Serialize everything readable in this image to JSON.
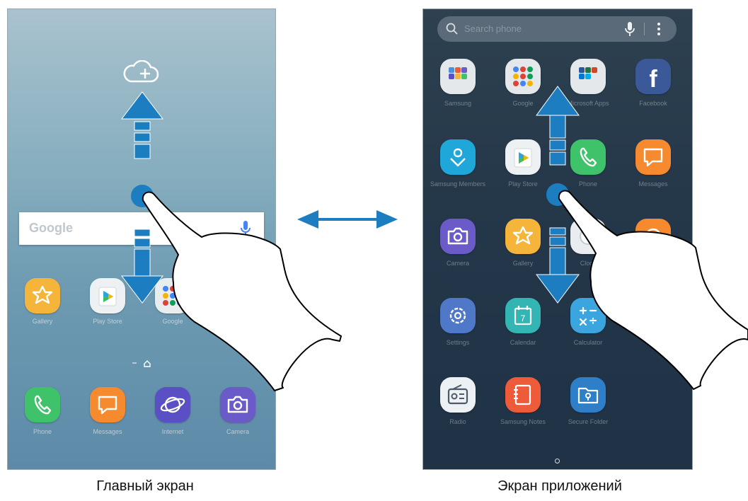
{
  "home_screen": {
    "caption": "Главный экран",
    "google_bar": {
      "logo": "Google"
    },
    "apps": [
      {
        "label": "Gallery",
        "icon": "gallery-icon",
        "color": "#f4b53a"
      },
      {
        "label": "Play Store",
        "icon": "play-store-icon",
        "color": "#eef1f3"
      },
      {
        "label": "Google",
        "icon": "google-folder-icon",
        "color": "#e9edf0"
      }
    ],
    "dock": [
      {
        "label": "Phone",
        "icon": "phone-icon",
        "color": "#3ec26a"
      },
      {
        "label": "Messages",
        "icon": "messages-icon",
        "color": "#f58a2e"
      },
      {
        "label": "Internet",
        "icon": "internet-icon",
        "color": "#5a4fc4"
      },
      {
        "label": "Camera",
        "icon": "camera-icon",
        "color": "#6b5bc9"
      }
    ]
  },
  "apps_screen": {
    "caption": "Экран приложений",
    "search_placeholder": "Search phone",
    "apps": [
      {
        "label": "Samsung",
        "icon": "samsung-folder-icon",
        "color": "#e4e8eb"
      },
      {
        "label": "Google",
        "icon": "google-folder-icon",
        "color": "#e4e8eb"
      },
      {
        "label": "Microsoft Apps",
        "icon": "microsoft-folder-icon",
        "color": "#e4e8eb"
      },
      {
        "label": "Facebook",
        "icon": "facebook-icon",
        "color": "#3b5998"
      },
      {
        "label": "Samsung Members",
        "icon": "samsung-members-icon",
        "color": "#1ea7d8"
      },
      {
        "label": "Play Store",
        "icon": "play-store-icon",
        "color": "#eef1f3"
      },
      {
        "label": "Phone",
        "icon": "phone-icon",
        "color": "#3ec26a"
      },
      {
        "label": "Messages",
        "icon": "messages-icon",
        "color": "#f58a2e"
      },
      {
        "label": "Camera",
        "icon": "camera-icon",
        "color": "#6b5bc9"
      },
      {
        "label": "Gallery",
        "icon": "gallery-icon",
        "color": "#f4b53a"
      },
      {
        "label": "Clock",
        "icon": "clock-icon",
        "color": "#e9edf0"
      },
      {
        "label": "",
        "icon": "orange-app-icon",
        "color": "#f58a2e"
      },
      {
        "label": "Settings",
        "icon": "settings-icon",
        "color": "#4f78c9"
      },
      {
        "label": "Calendar",
        "icon": "calendar-icon",
        "color": "#33b6b3"
      },
      {
        "label": "Calculator",
        "icon": "calculator-icon",
        "color": "#3aa5de"
      },
      {
        "label": "",
        "icon": "partial-app-icon",
        "color": "#25384a"
      },
      {
        "label": "Radio",
        "icon": "radio-icon",
        "color": "#eef1f3"
      },
      {
        "label": "Samsung Notes",
        "icon": "samsung-notes-icon",
        "color": "#ee5b3b"
      },
      {
        "label": "Secure Folder",
        "icon": "secure-folder-icon",
        "color": "#2e7fc8"
      }
    ],
    "calendar_day": "7"
  },
  "colors": {
    "arrow": "#1c7ec0",
    "gesture_dot": "#1c7ec0"
  }
}
